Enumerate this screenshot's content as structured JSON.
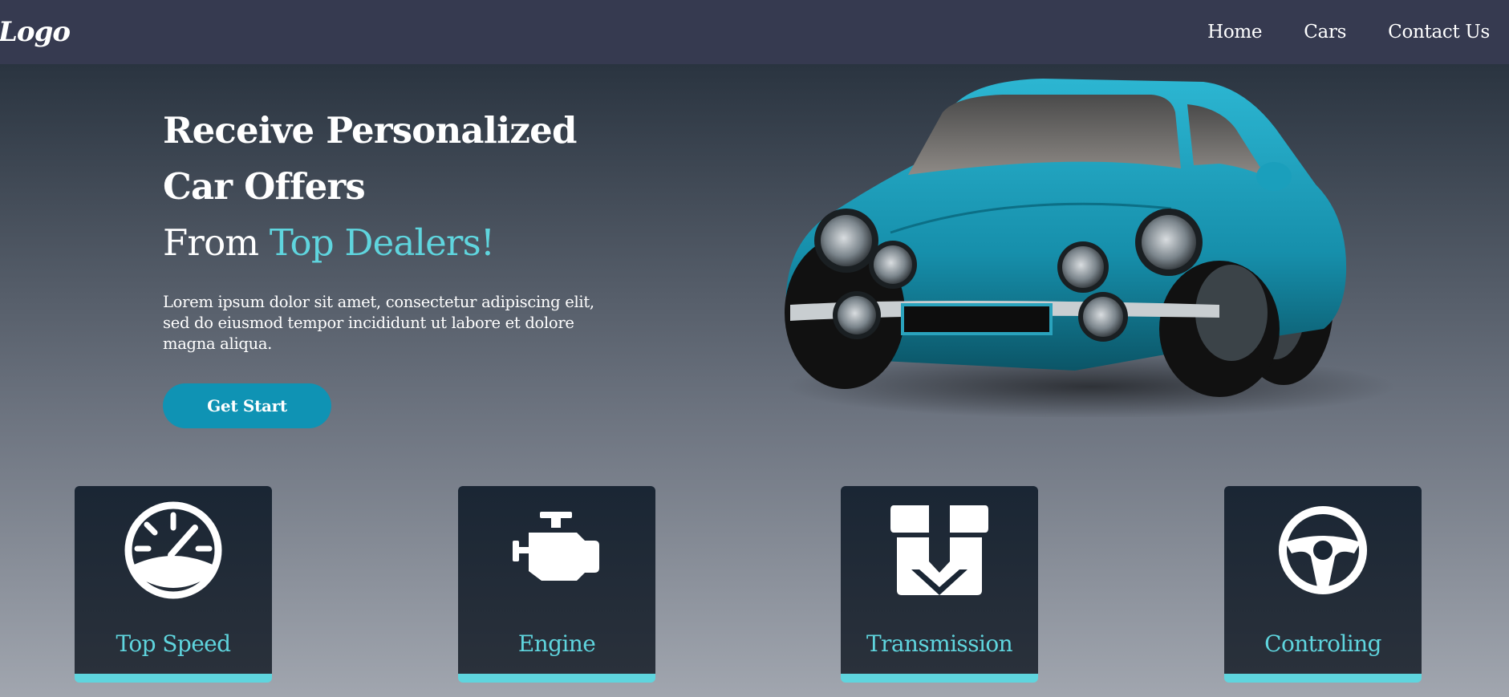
{
  "nav": {
    "logo": "Logo",
    "links": [
      "Home",
      "Cars",
      "Contact Us"
    ]
  },
  "hero": {
    "headline_line1": "Receive Personalized",
    "headline_line2": "Car Offers",
    "sub_prefix": "From ",
    "sub_accent": "Top Dealers!",
    "lead": "Lorem ipsum dolor sit amet, consectetur adipiscing elit, sed do eiusmod tempor incididunt ut labore et dolore magna aliqua.",
    "cta": "Get Start"
  },
  "features": [
    {
      "label": "Top Speed",
      "icon": "speedometer-icon"
    },
    {
      "label": "Engine",
      "icon": "engine-icon"
    },
    {
      "label": "Transmission",
      "icon": "transmission-icon"
    },
    {
      "label": "Controling",
      "icon": "steering-wheel-icon"
    }
  ],
  "colors": {
    "navbar": "#363a50",
    "accent": "#5fd5de",
    "button": "#0f93b4",
    "card": "#1a2634",
    "car_body": "#1da0bd"
  }
}
